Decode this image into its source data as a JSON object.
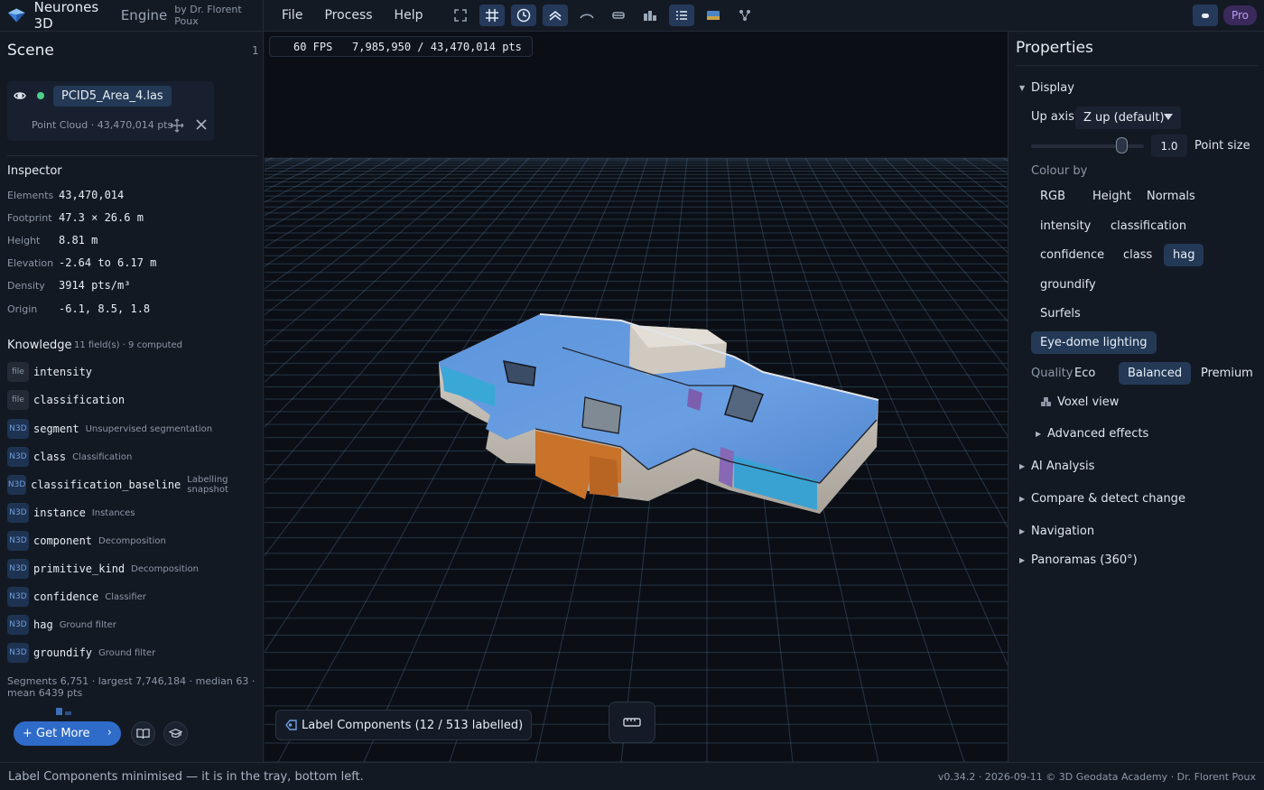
{
  "app": {
    "name": "Neurones 3D",
    "engine": "Engine",
    "byline": "by Dr. Florent Poux"
  },
  "menu": [
    "File",
    "Process",
    "Help"
  ],
  "toolbar": [
    {
      "icon": "fullscreen-icon",
      "active": false
    },
    {
      "icon": "grid-icon",
      "active": true
    },
    {
      "icon": "orbit-icon",
      "active": true
    },
    {
      "icon": "layers-icon",
      "active": true
    },
    {
      "icon": "curve-icon",
      "active": false
    },
    {
      "icon": "section-icon",
      "active": false
    },
    {
      "icon": "blocks-icon",
      "active": false
    },
    {
      "icon": "list-icon",
      "active": true
    },
    {
      "icon": "image-icon",
      "active": false
    },
    {
      "icon": "nodes-icon",
      "active": false
    }
  ],
  "account": {
    "pro_label": "Pro"
  },
  "scene": {
    "title": "Scene",
    "count": "1",
    "item": {
      "file": "PCID5_Area_4.las",
      "meta": "Point Cloud · 43,470,014 pts"
    }
  },
  "inspector": {
    "title": "Inspector",
    "rows": [
      {
        "key": "Elements",
        "value": "43,470,014"
      },
      {
        "key": "Footprint",
        "value": "47.3 × 26.6 m"
      },
      {
        "key": "Height",
        "value": "8.81 m"
      },
      {
        "key": "Elevation",
        "value": "-2.64 to 6.17 m"
      },
      {
        "key": "Density",
        "value": "3914 pts/m³"
      },
      {
        "key": "Origin",
        "value": "-6.1, 8.5, 1.8"
      }
    ]
  },
  "knowledge": {
    "title": "Knowledge",
    "subtitle": "11 field(s) · 9 computed",
    "fields": [
      {
        "badge": "file",
        "name": "intensity",
        "desc": ""
      },
      {
        "badge": "file",
        "name": "classification",
        "desc": ""
      },
      {
        "badge": "N3D",
        "name": "segment",
        "desc": "Unsupervised segmentation"
      },
      {
        "badge": "N3D",
        "name": "class",
        "desc": "Classification"
      },
      {
        "badge": "N3D",
        "name": "classification_baseline",
        "desc": "Labelling snapshot"
      },
      {
        "badge": "N3D",
        "name": "instance",
        "desc": "Instances"
      },
      {
        "badge": "N3D",
        "name": "component",
        "desc": "Decomposition"
      },
      {
        "badge": "N3D",
        "name": "primitive_kind",
        "desc": "Decomposition"
      },
      {
        "badge": "N3D",
        "name": "confidence",
        "desc": "Classifier"
      },
      {
        "badge": "N3D",
        "name": "hag",
        "desc": "Ground filter"
      },
      {
        "badge": "N3D",
        "name": "groundify",
        "desc": "Ground filter"
      }
    ],
    "segments_text": "Segments 6,751 · largest 7,746,184 · median 63 · mean 6439 pts"
  },
  "left_footer": {
    "get_more": "+ Get More",
    "chevron": "›"
  },
  "viewport": {
    "fps_text": "60 FPS   7,985,950 / 43,470,014 pts",
    "label_tray": "Label Components  (12 / 513 labelled)"
  },
  "properties": {
    "title": "Properties",
    "display_section": "Display",
    "up_axis_label": "Up axis",
    "up_axis_value": "Z up (default)",
    "point_size_value": "1.0",
    "point_size_label": "Point size",
    "point_size_fraction": 0.8,
    "colour_by_label": "Colour by",
    "colour_options": [
      {
        "label": "RGB",
        "active": false
      },
      {
        "label": "Height",
        "active": false
      },
      {
        "label": "Normals",
        "active": false
      },
      {
        "label": "intensity",
        "active": false
      },
      {
        "label": "classification",
        "active": false
      },
      {
        "label": "confidence",
        "active": false
      },
      {
        "label": "class",
        "active": false
      },
      {
        "label": "hag",
        "active": true
      },
      {
        "label": "groundify",
        "active": false
      },
      {
        "label": "Surfels",
        "active": false
      }
    ],
    "eye_dome": "Eye-dome lighting",
    "quality_label": "Quality",
    "quality_options": [
      {
        "label": "Eco",
        "active": false
      },
      {
        "label": "Balanced",
        "active": true
      },
      {
        "label": "Premium",
        "active": false
      }
    ],
    "voxel_view": "Voxel view",
    "advanced_effects": "Advanced effects",
    "sections": [
      "AI Analysis",
      "Compare & detect change",
      "Navigation",
      "Panoramas (360°)"
    ]
  },
  "status": {
    "message": "Label Components minimised — it is in the tray, bottom left.",
    "version": "v0.34.2 · 2026-09-11  © 3D Geodata Academy · Dr. Florent Poux"
  },
  "colors": {
    "accent": "#2f6bc9",
    "active_chip": "#233955",
    "pro": "#b79cf0",
    "online": "#4fd08a"
  }
}
